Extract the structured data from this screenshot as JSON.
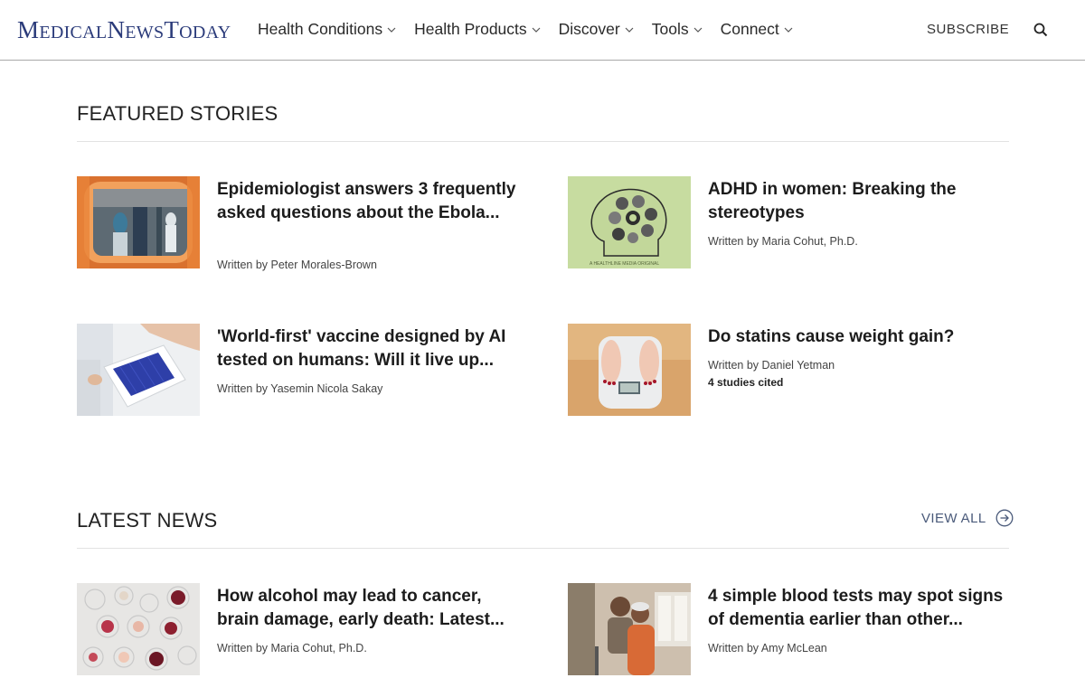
{
  "header": {
    "logo": {
      "m": "M",
      "edical": "EDICAL",
      "n": "N",
      "ews": "EWS",
      "t": "T",
      "oday": "ODAY"
    },
    "nav": [
      {
        "label": "Health Conditions"
      },
      {
        "label": "Health Products"
      },
      {
        "label": "Discover"
      },
      {
        "label": "Tools"
      },
      {
        "label": "Connect"
      }
    ],
    "subscribe_label": "SUBSCRIBE",
    "search_icon": "search-icon"
  },
  "featured": {
    "title": "FEATURED STORIES",
    "items": [
      {
        "title": "Epidemiologist answers 3 frequently asked questions about the Ebola...",
        "author": "Written by Peter Morales-Brown",
        "image": "ebola-workers-photo"
      },
      {
        "title": "ADHD in women: Breaking the stereotypes",
        "author": "Written by Maria Cohut, Ph.D.",
        "image": "adhd-illustration",
        "image_caption": "A HEALTHLINE MEDIA ORIGINAL"
      },
      {
        "title": "'World-first' vaccine designed by AI tested on humans: Will it live up...",
        "author": "Written by Yasemin Nicola Sakay",
        "image": "vaccine-vials-photo"
      },
      {
        "title": "Do statins cause weight gain?",
        "author": "Written by Daniel Yetman",
        "cited": "4 studies cited",
        "image": "scale-photo"
      }
    ]
  },
  "latest": {
    "title": "LATEST NEWS",
    "view_all_label": "VIEW ALL",
    "items": [
      {
        "title": "How alcohol may lead to cancer, brain damage, early death: Latest...",
        "author": "Written by Maria Cohut, Ph.D.",
        "image": "wine-glasses-photo"
      },
      {
        "title": "4 simple blood tests may spot signs of dementia earlier than other...",
        "author": "Written by Amy McLean",
        "image": "older-women-photo"
      }
    ]
  },
  "colors": {
    "logo": "#2b3b7a",
    "text": "#222222",
    "divider": "#e2e2e2",
    "header_border": "#a9a9a9"
  }
}
